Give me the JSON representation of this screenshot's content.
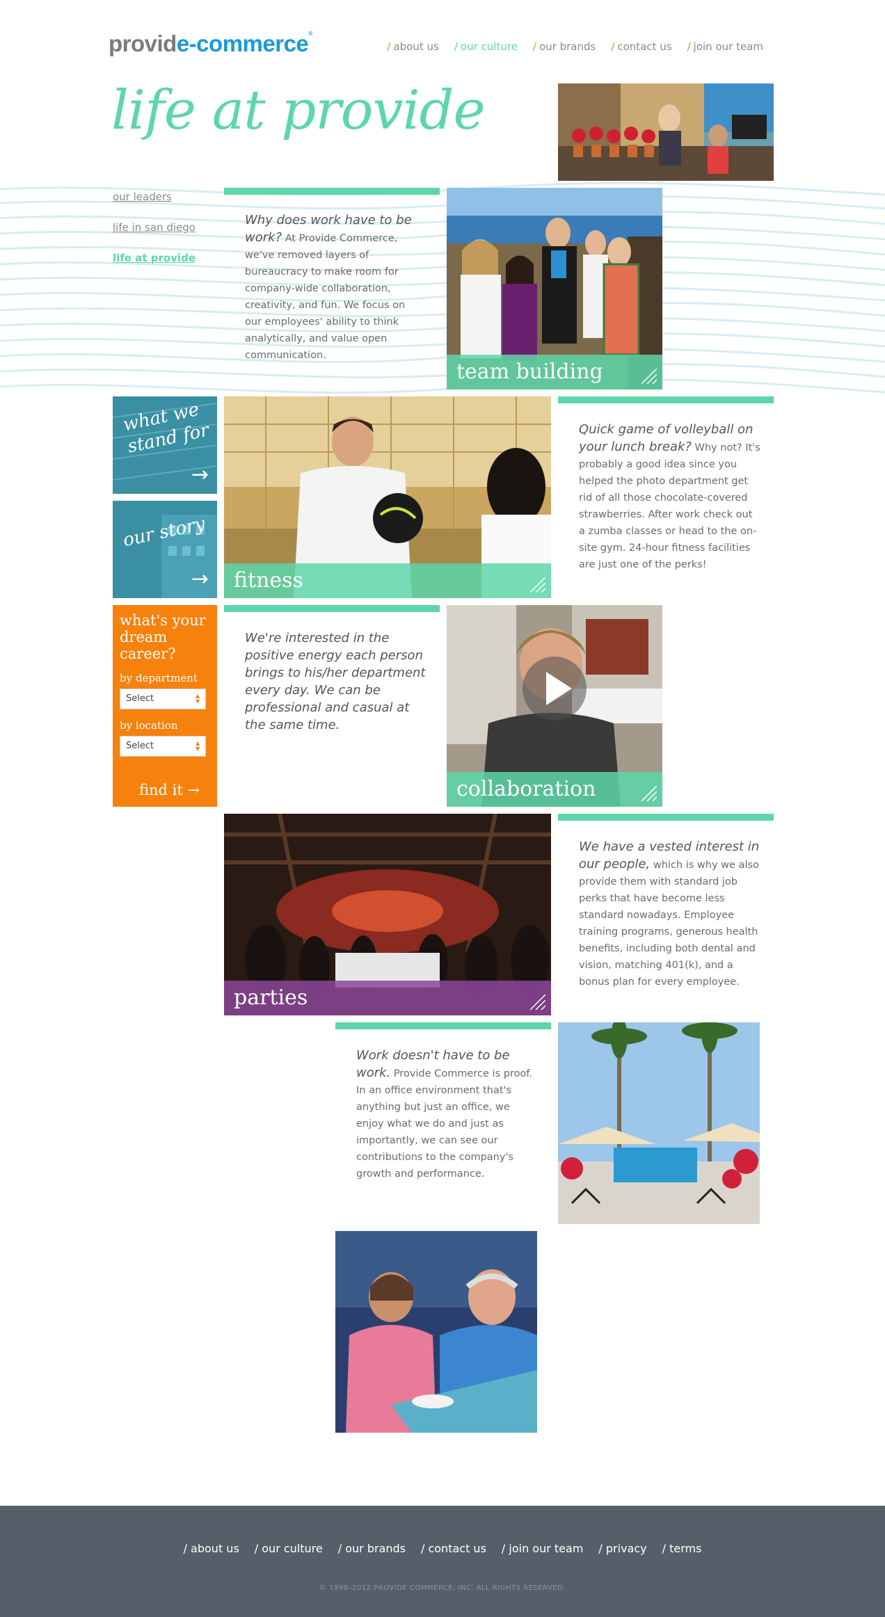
{
  "header": {
    "logo_part1": "provid",
    "logo_part2": "e-commerce",
    "logo_mark": "®",
    "nav": [
      {
        "label": "about us",
        "active": false
      },
      {
        "label": "our culture",
        "active": true
      },
      {
        "label": "our brands",
        "active": false
      },
      {
        "label": "contact us",
        "active": false
      },
      {
        "label": "join our team",
        "active": false
      }
    ]
  },
  "hero": {
    "title": "life at provide"
  },
  "sidebar": {
    "items": [
      {
        "label": "our leaders"
      },
      {
        "label": "life in san diego"
      },
      {
        "label": "life at provide"
      }
    ]
  },
  "tiles": {
    "stand": {
      "label": "what we stand for",
      "arrow": "→"
    },
    "story": {
      "label": "our story",
      "arrow": "→"
    }
  },
  "career": {
    "title": "what's your dream career?",
    "by_department": "by department",
    "by_location": "by location",
    "select_value": "Select",
    "find": "find it",
    "find_arrow": "→"
  },
  "blocks": {
    "work": {
      "lead": "Why does work have to be work?",
      "body": " At Provide Commerce, we've removed layers of bureaucracy to make room for company-wide collaboration, creativity, and fun. We focus on our employees' ability to think analytically, and value open communication."
    },
    "volley": {
      "lead": "Quick game of volleyball on your lunch break?",
      "body": " Why not? It's probably a good idea since you helped the photo department get rid of all those chocolate-covered strawberries. After work check out a zumba classes or head to the on-site gym. 24-hour fitness facilities are just one of the perks!"
    },
    "energy": {
      "lead": "We're interested in the positive energy each person brings to his/her department every day. We can be professional and casual at the same time.",
      "body": ""
    },
    "people": {
      "lead": "We have a vested interest in our people,",
      "body": " which is why we also provide them with standard job perks that have become less standard nowadays. Employee training programs, generous health benefits, including both dental and vision, matching 401(k), and a bonus plan for every employee."
    },
    "proof": {
      "lead": "Work doesn't have to be work.",
      "body": " Provide Commerce is proof. In an office environment that's anything but just an office, we enjoy what we do and just as importantly, we can see our contributions to the company's growth and performance."
    }
  },
  "captions": {
    "team": "team building",
    "fitness": "fitness",
    "collab": "collaboration",
    "parties": "parties"
  },
  "footer": {
    "nav": [
      "about us",
      "our culture",
      "our brands",
      "contact us",
      "join our team",
      "privacy",
      "terms"
    ],
    "copyright": "© 1998–2012 PROVIDE COMMERCE, INC. ALL RIGHTS RESERVED."
  },
  "colors": {
    "mint": "#5dd6a8",
    "orange": "#f7810d",
    "blue": "#1b9ad6",
    "footer": "#565f69",
    "purple": "#8c4696"
  }
}
